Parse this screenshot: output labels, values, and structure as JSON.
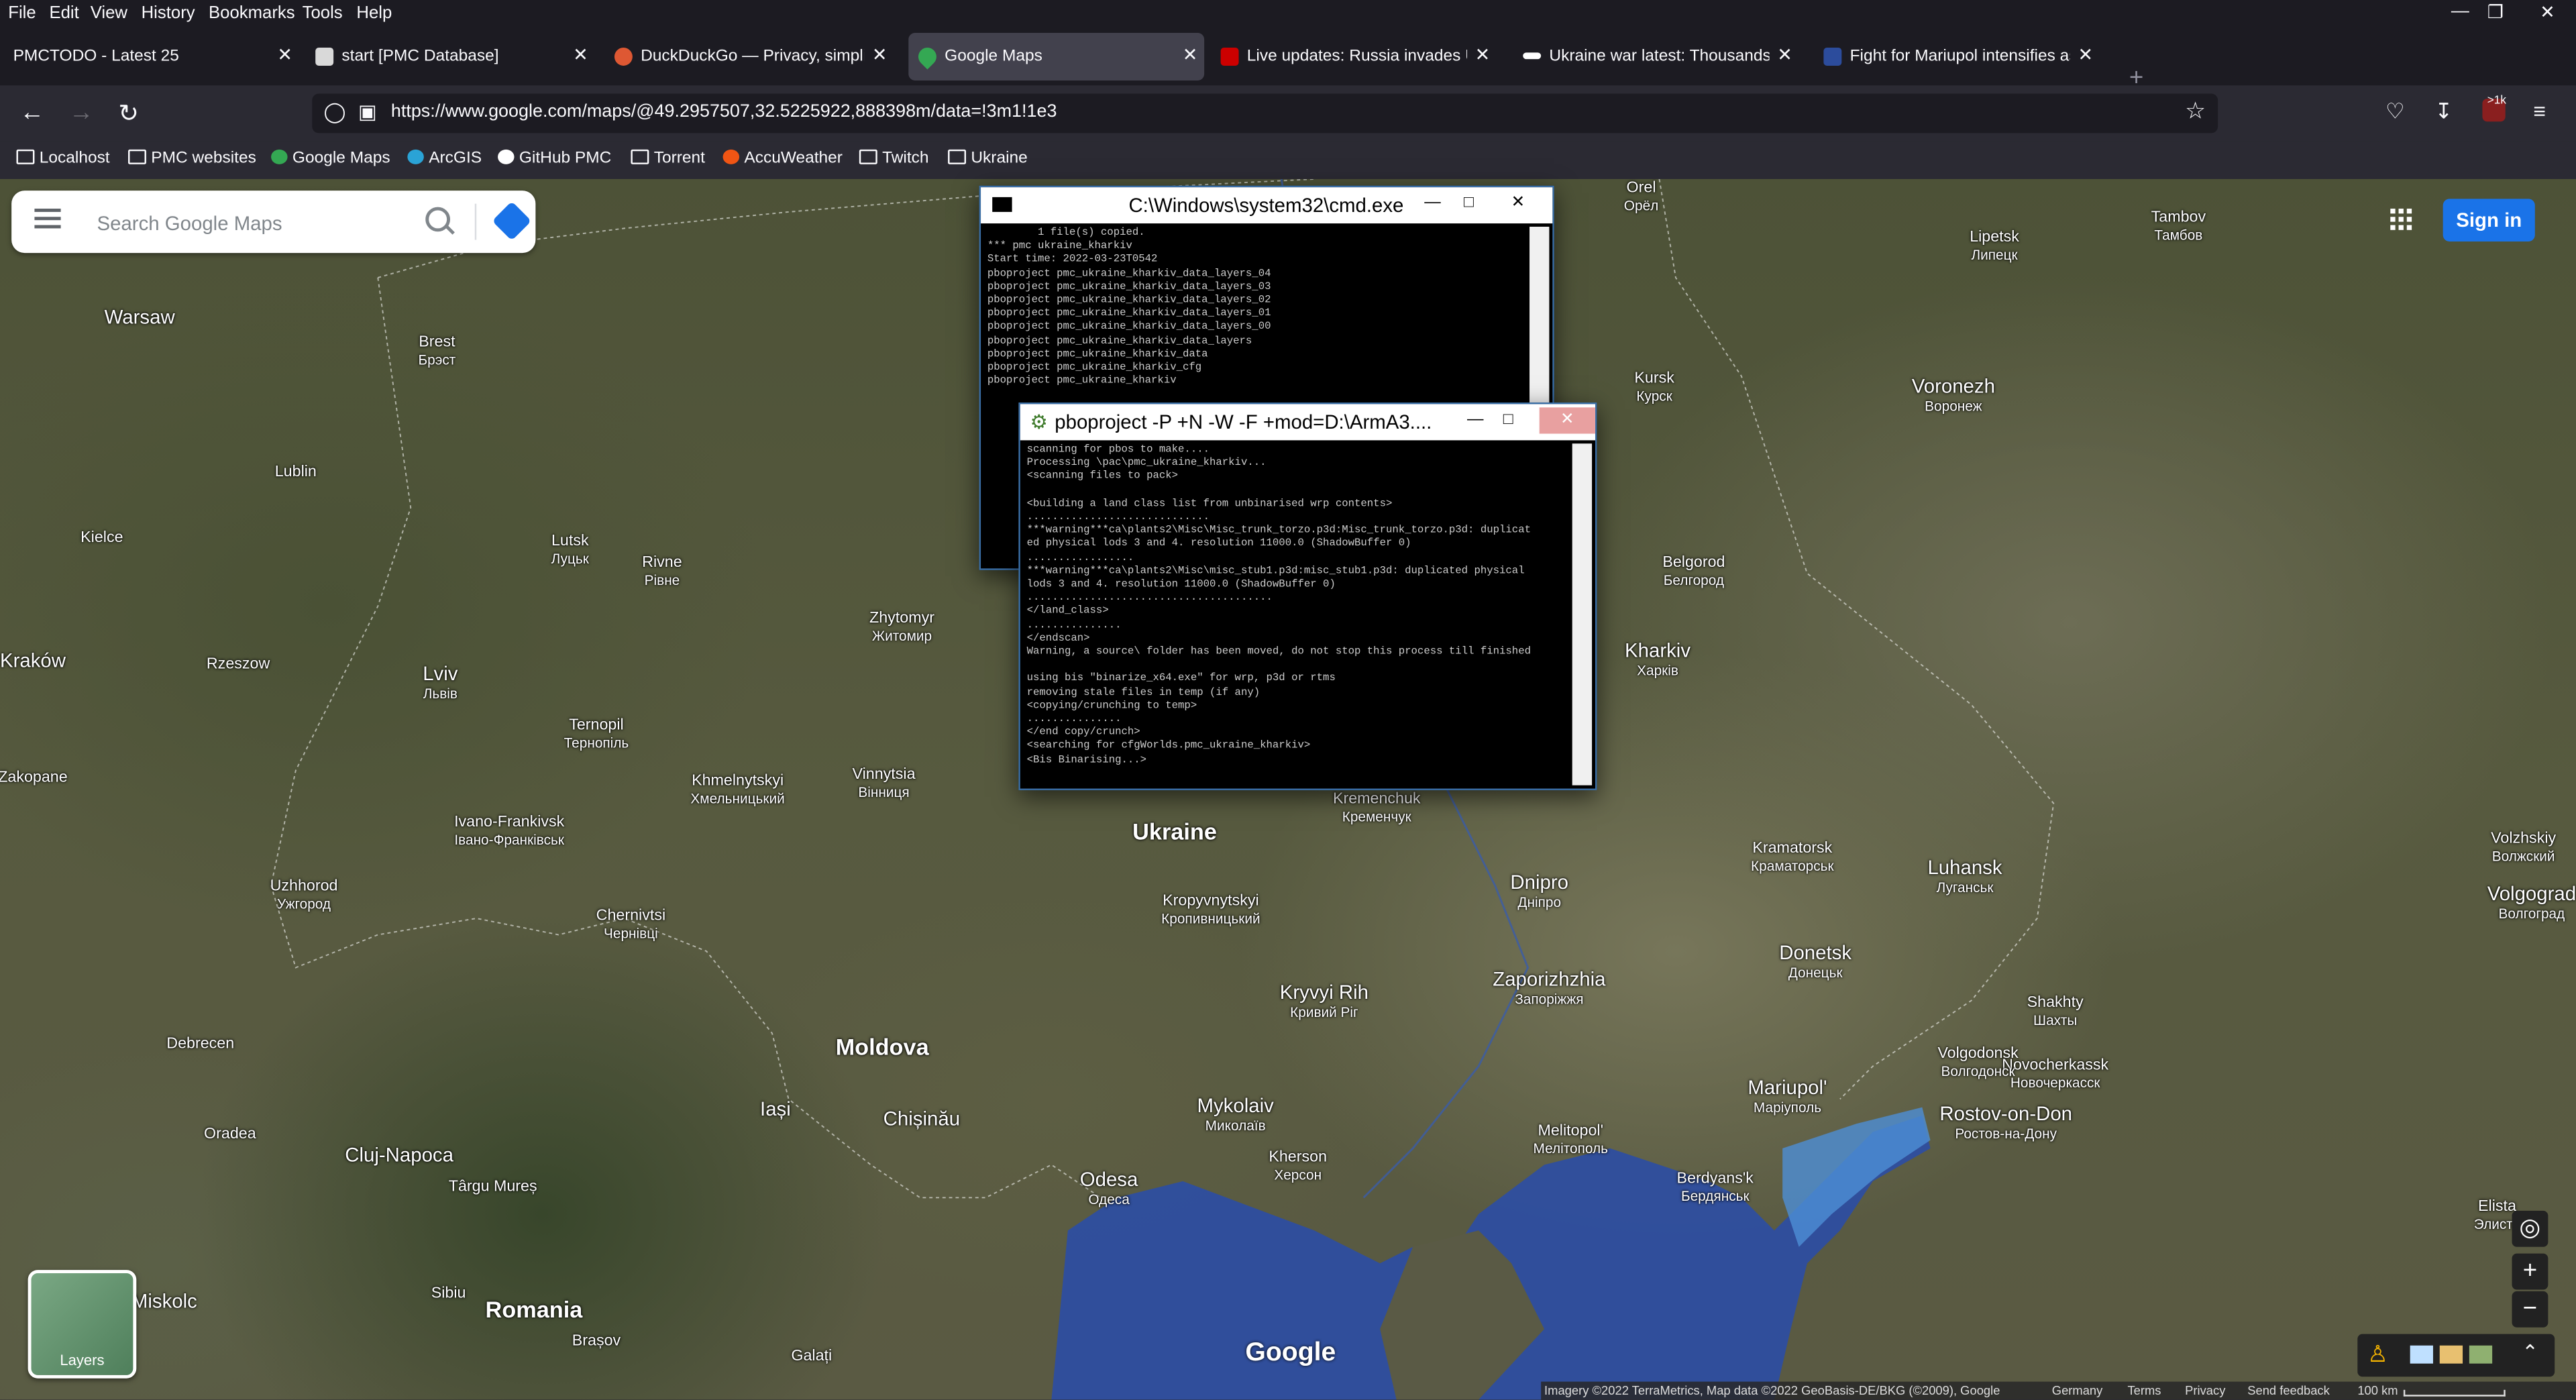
{
  "menubar": {
    "items": [
      "File",
      "Edit",
      "View",
      "History",
      "Bookmarks",
      "Tools",
      "Help"
    ]
  },
  "tabs": [
    {
      "title": "PMCTODO - Latest 25",
      "active": false,
      "favicon": "none"
    },
    {
      "title": "start [PMC Database]",
      "active": false,
      "favicon": "wiki-icon"
    },
    {
      "title": "DuckDuckGo — Privacy, simplified.",
      "active": false,
      "favicon": "duckduckgo-icon"
    },
    {
      "title": "Google Maps",
      "active": true,
      "favicon": "google-maps-icon"
    },
    {
      "title": "Live updates: Russia invades Ukraine",
      "active": false,
      "favicon": "cnn-icon"
    },
    {
      "title": "Ukraine war latest: Thousands flee",
      "active": false,
      "favicon": "news-icon"
    },
    {
      "title": "Fight for Mariupol intensifies as",
      "active": false,
      "favicon": "news-icon"
    }
  ],
  "nav": {
    "url": "https://www.google.com/maps/@49.2957507,32.5225922,888398m/data=!3m1!1e3",
    "notif_badge": ">1k"
  },
  "bookmarks": [
    "Localhost",
    "PMC websites",
    "Google Maps",
    "ArcGIS",
    "GitHub PMC",
    "Torrent",
    "AccuWeather",
    "Twitch",
    "Ukraine"
  ],
  "maps": {
    "search_placeholder": "Search Google Maps",
    "signin_label": "Sign in",
    "layers_label": "Layers",
    "logo": "Google",
    "attribution": "Imagery ©2022 TerraMetrics, Map data ©2022 GeoBasis-DE/BKG (©2009), Google",
    "footer_country": "Germany",
    "footer_terms": "Terms",
    "footer_privacy": "Privacy",
    "footer_feedback": "Send feedback",
    "scale": "100 km"
  },
  "cities": [
    {
      "name": "Warsaw",
      "native": ""
    },
    {
      "name": "Brest",
      "native": "Брэст"
    },
    {
      "name": "Lublin",
      "native": ""
    },
    {
      "name": "Kielce",
      "native": ""
    },
    {
      "name": "Lutsk",
      "native": "Луцьк"
    },
    {
      "name": "Rivne",
      "native": "Рівне"
    },
    {
      "name": "Kraków",
      "native": ""
    },
    {
      "name": "Rzeszow",
      "native": ""
    },
    {
      "name": "Lviv",
      "native": "Львів"
    },
    {
      "name": "Ternopil",
      "native": "Тернопіль"
    },
    {
      "name": "Zhytomyr",
      "native": "Житомир"
    },
    {
      "name": "Khmelnytskyi",
      "native": "Хмельницький"
    },
    {
      "name": "Vinnytsia",
      "native": "Вінниця"
    },
    {
      "name": "Zakopane",
      "native": ""
    },
    {
      "name": "Ivano-Frankivsk",
      "native": "Івано-Франківськ"
    },
    {
      "name": "Uzhhorod",
      "native": "Ужгород"
    },
    {
      "name": "Chernivtsi",
      "native": "Чернівці"
    },
    {
      "name": "Debrecen",
      "native": ""
    },
    {
      "name": "Oradea",
      "native": ""
    },
    {
      "name": "Cluj-Napoca",
      "native": ""
    },
    {
      "name": "Târgu Mureș",
      "native": ""
    },
    {
      "name": "Sibiu",
      "native": ""
    },
    {
      "name": "Brașov",
      "native": ""
    },
    {
      "name": "Romania",
      "native": ""
    },
    {
      "name": "Miskolc",
      "native": ""
    },
    {
      "name": "Moldova",
      "native": ""
    },
    {
      "name": "Iași",
      "native": ""
    },
    {
      "name": "Chișinău",
      "native": ""
    },
    {
      "name": "Galați",
      "native": ""
    },
    {
      "name": "Odesa",
      "native": "Одеса"
    },
    {
      "name": "Mykolaiv",
      "native": "Миколаїв"
    },
    {
      "name": "Kherson",
      "native": "Херсон"
    },
    {
      "name": "Kryvyi Rih",
      "native": "Кривий Ріг"
    },
    {
      "name": "Kropyvnytskyi",
      "native": "Кропивницький"
    },
    {
      "name": "Ukraine",
      "native": ""
    },
    {
      "name": "Kremenchuk",
      "native": "Кременчук"
    },
    {
      "name": "Dnipro",
      "native": "Дніпро"
    },
    {
      "name": "Zaporizhzhia",
      "native": "Запоріжжя"
    },
    {
      "name": "Melitopol'",
      "native": "Мелітополь"
    },
    {
      "name": "Berdyans'k",
      "native": "Бердянськ"
    },
    {
      "name": "Mariupol'",
      "native": "Маріуполь"
    },
    {
      "name": "Donetsk",
      "native": "Донецьк"
    },
    {
      "name": "Kramatorsk",
      "native": "Краматорськ"
    },
    {
      "name": "Luhansk",
      "native": "Луганськ"
    },
    {
      "name": "Kharkiv",
      "native": "Харків"
    },
    {
      "name": "Belgorod",
      "native": "Белгород"
    },
    {
      "name": "Kursk",
      "native": "Курск"
    },
    {
      "name": "Voronezh",
      "native": "Воронеж"
    },
    {
      "name": "Lipetsk",
      "native": "Липецк"
    },
    {
      "name": "Tambov",
      "native": "Тамбов"
    },
    {
      "name": "Orel",
      "native": "Орёл"
    },
    {
      "name": "Shakhty",
      "native": "Шахты"
    },
    {
      "name": "Novocherkassk",
      "native": "Новочеркасск"
    },
    {
      "name": "Rostov-on-Don",
      "native": "Ростов-на-Дону"
    },
    {
      "name": "Volgodonsk",
      "native": "Волгодонск"
    },
    {
      "name": "Volgograd",
      "native": "Волгоград"
    },
    {
      "name": "Volzhskiy",
      "native": "Волжский"
    },
    {
      "name": "Elista",
      "native": "Элиста"
    }
  ],
  "cmd_window": {
    "title": "C:\\Windows\\system32\\cmd.exe",
    "lines": [
      "        1 file(s) copied.",
      "*** pmc ukraine_kharkiv",
      "Start time: 2022-03-23T0542",
      "pboproject pmc_ukraine_kharkiv_data_layers_04",
      "pboproject pmc_ukraine_kharkiv_data_layers_03",
      "pboproject pmc_ukraine_kharkiv_data_layers_02",
      "pboproject pmc_ukraine_kharkiv_data_layers_01",
      "pboproject pmc_ukraine_kharkiv_data_layers_00",
      "pboproject pmc_ukraine_kharkiv_data_layers",
      "pboproject pmc_ukraine_kharkiv_data",
      "pboproject pmc_ukraine_kharkiv_cfg",
      "pboproject pmc_ukraine_kharkiv"
    ]
  },
  "pbo_window": {
    "title": "pboproject -P +N -W -F +mod=D:\\ArmA3....",
    "lines": [
      "scanning for pbos to make....",
      "Processing \\pac\\pmc_ukraine_kharkiv...",
      "<scanning files to pack>",
      "",
      "<building a land class list from unbinarised wrp contents>",
      ".............................",
      "***warning***ca\\plants2\\Misc\\Misc_trunk_torzo.p3d:Misc_trunk_torzo.p3d: duplicat",
      "ed physical lods 3 and 4. resolution 11000.0 (ShadowBuffer 0)",
      ".................",
      "***warning***ca\\plants2\\Misc\\misc_stub1.p3d:misc_stub1.p3d: duplicated physical",
      "lods 3 and 4. resolution 11000.0 (ShadowBuffer 0)",
      ".......................................",
      "</land_class>",
      "...............",
      "</endscan>",
      "Warning, a source\\ folder has been moved, do not stop this process till finished",
      "",
      "using bis \"binarize_x64.exe\" for wrp, p3d or rtms",
      "removing stale files in temp (if any)",
      "<copying/crunching to temp>",
      "...............",
      "</end copy/crunch>",
      "<searching for cfgWorlds.pmc_ukraine_kharkiv>",
      "<Bis Binarising...>"
    ]
  }
}
